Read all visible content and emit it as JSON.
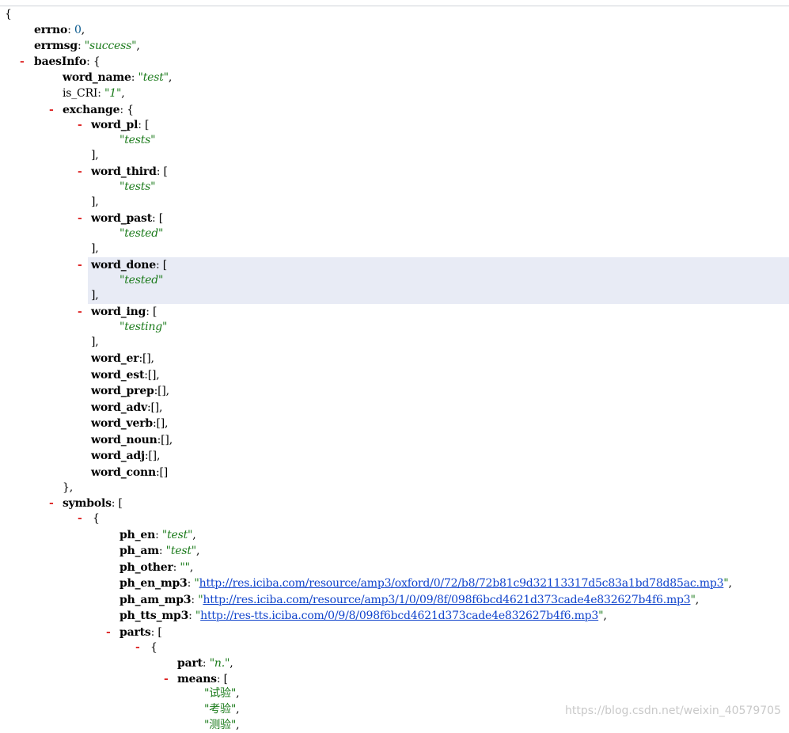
{
  "punct": {
    "open_brace": "{",
    "close_brace_comma": "},",
    "open_bracket": "[",
    "close_bracket_comma": "],",
    "empty_arr_comma": "[],",
    "empty_arr": "[]",
    "colon": ":",
    "colon_sp": ": ",
    "comma": ",",
    "toggle": "-"
  },
  "json": {
    "errno": {
      "key": "errno",
      "value": "0"
    },
    "errmsg": {
      "key": "errmsg",
      "value": "\"success\""
    },
    "baesInfo": {
      "key": "baesInfo"
    },
    "word_name": {
      "key": "word_name",
      "value": "\"test\""
    },
    "is_CRI": {
      "key": "is_CRI",
      "value": "\"1\""
    },
    "exchange": {
      "key": "exchange"
    },
    "word_pl": {
      "key": "word_pl",
      "value": "\"tests\""
    },
    "word_third": {
      "key": "word_third",
      "value": "\"tests\""
    },
    "word_past": {
      "key": "word_past",
      "value": "\"tested\""
    },
    "word_done": {
      "key": "word_done",
      "value": "\"tested\""
    },
    "word_ing": {
      "key": "word_ing",
      "value": "\"testing\""
    },
    "empty_keys": [
      "word_er",
      "word_est",
      "word_prep",
      "word_adv",
      "word_verb",
      "word_noun",
      "word_adj",
      "word_conn"
    ],
    "symbols": {
      "key": "symbols"
    },
    "ph_en": {
      "key": "ph_en",
      "value": "\"test\""
    },
    "ph_am": {
      "key": "ph_am",
      "value": "\"test\""
    },
    "ph_other": {
      "key": "ph_other",
      "value": "\"\""
    },
    "ph_en_mp3": {
      "key": "ph_en_mp3",
      "url": "http://res.iciba.com/resource/amp3/oxford/0/72/b8/72b81c9d32113317d5c83a1bd78d85ac.mp3"
    },
    "ph_am_mp3": {
      "key": "ph_am_mp3",
      "url": "http://res.iciba.com/resource/amp3/1/0/09/8f/098f6bcd4621d373cade4e832627b4f6.mp3"
    },
    "ph_tts_mp3": {
      "key": "ph_tts_mp3",
      "url": "http://res-tts.iciba.com/0/9/8/098f6bcd4621d373cade4e832627b4f6.mp3"
    },
    "parts": {
      "key": "parts"
    },
    "part": {
      "key": "part",
      "value": "\"n.\""
    },
    "means": {
      "key": "means",
      "values": [
        "\"试验\"",
        "\"考验\"",
        "\"测验\""
      ]
    }
  },
  "watermark": "https://blog.csdn.net/weixin_40579705"
}
